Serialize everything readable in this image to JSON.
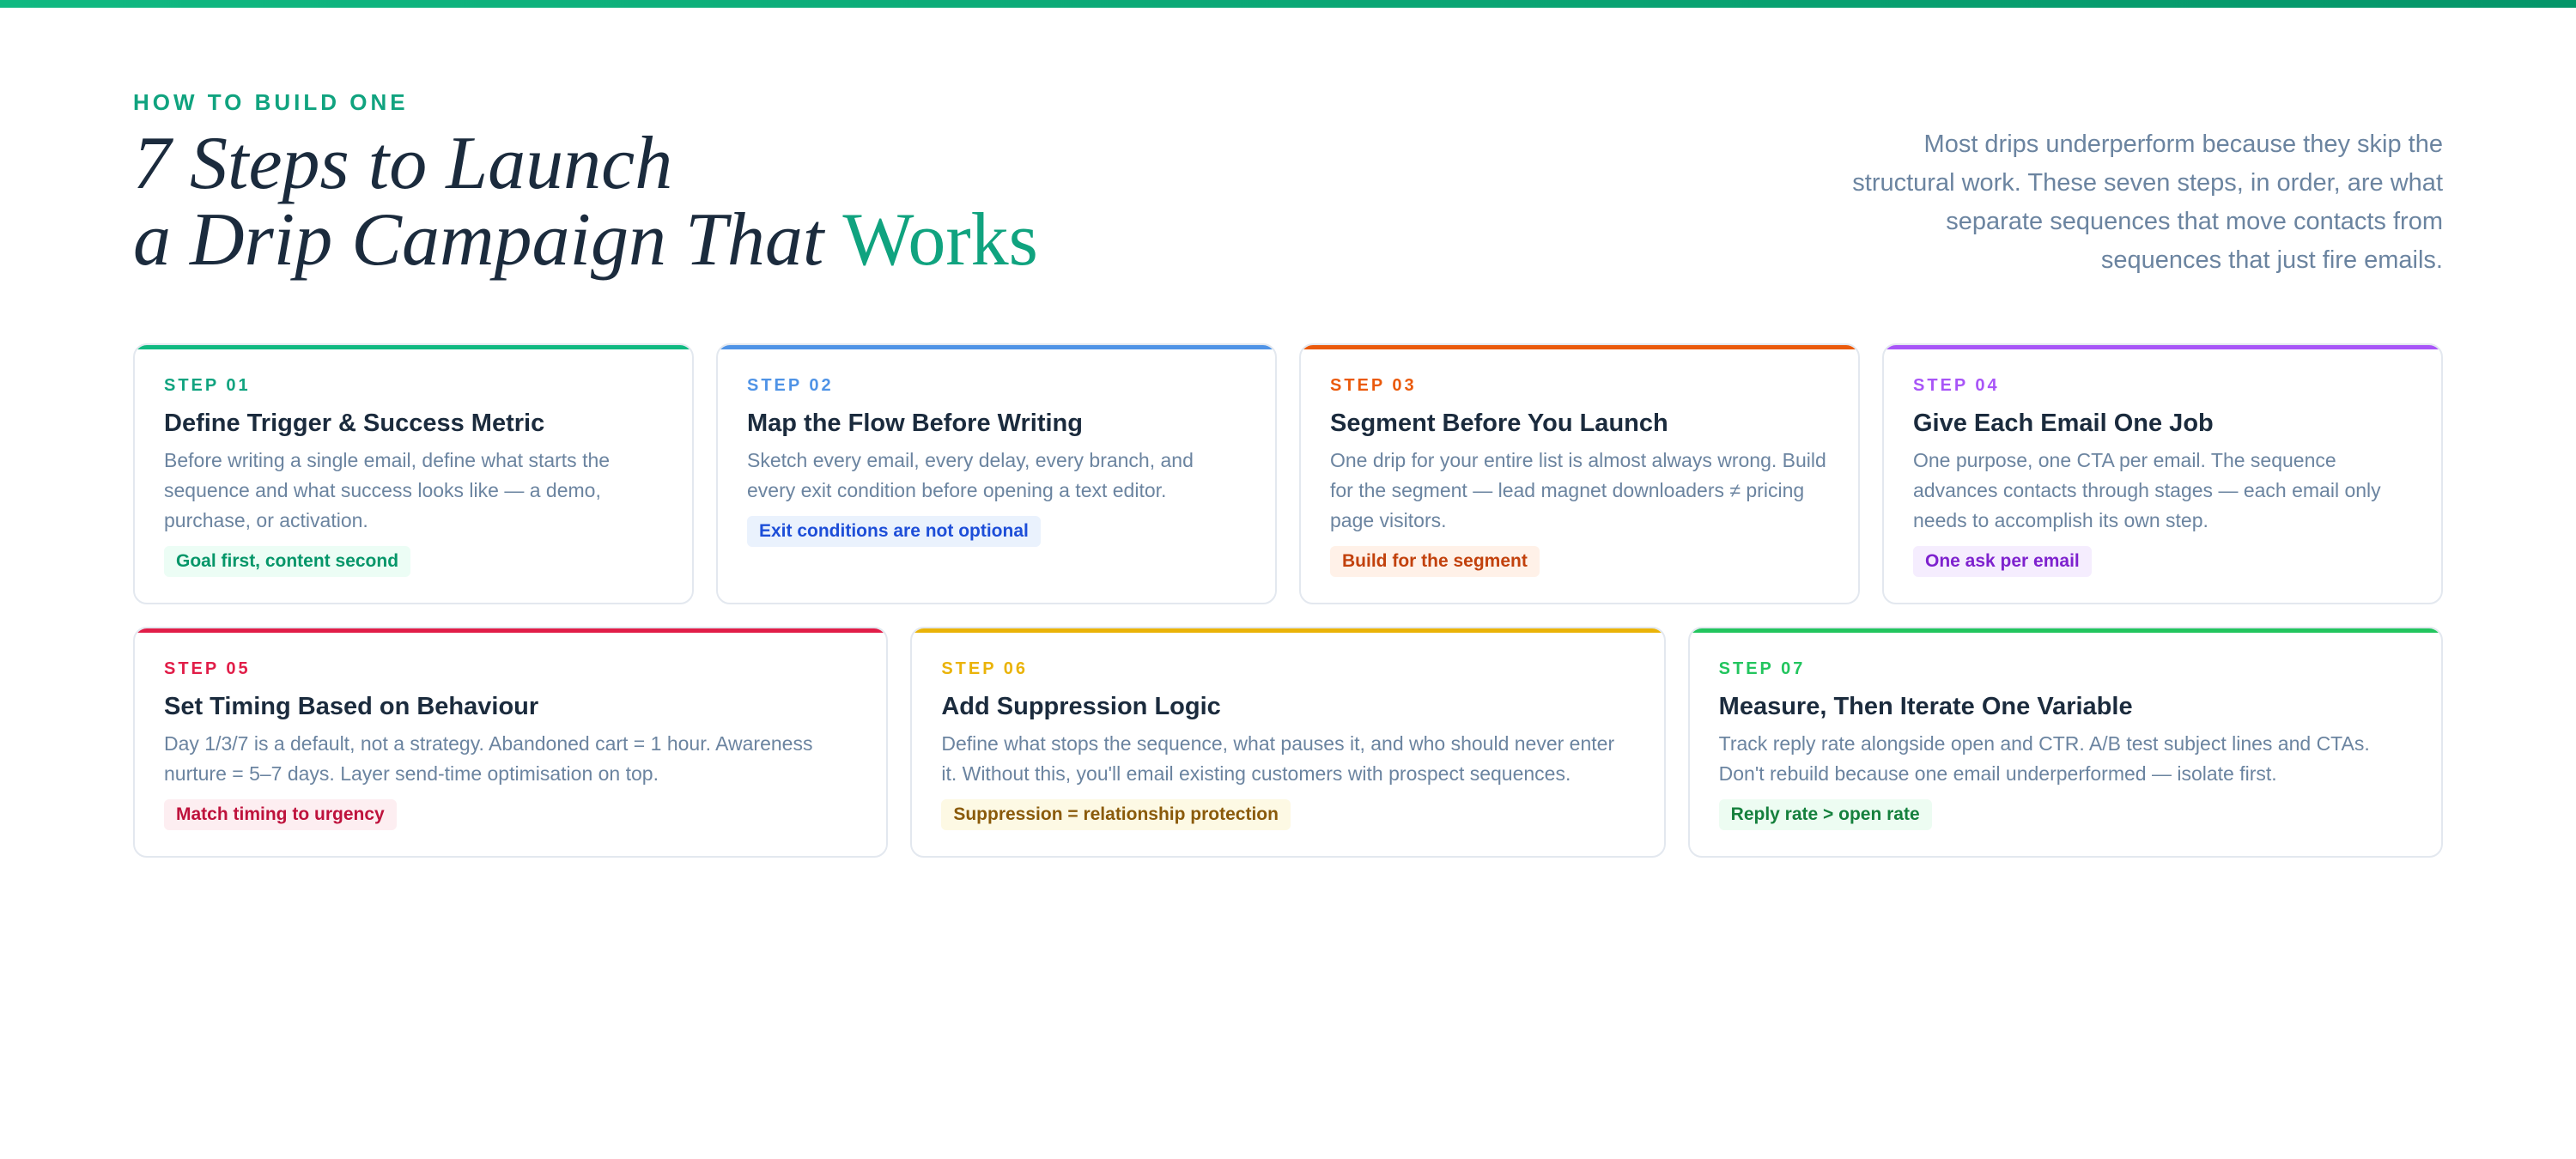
{
  "header": {
    "eyebrow": "HOW TO BUILD ONE",
    "title_line1": "7 Steps to Launch",
    "title_line2_prefix": "a Drip Campaign That ",
    "title_line2_accent": "Works",
    "intro": "Most drips underperform because they skip the structural work. These seven steps, in order, are what separate sequences that move contacts from sequences that just fire emails."
  },
  "steps": [
    {
      "label": "STEP 01",
      "title": "Define Trigger & Success Metric",
      "description": "Before writing a single email, define what starts the sequence and what success looks like — a demo, purchase, or activation.",
      "tag": "Goal first, content second",
      "accent_color": "#10b981"
    },
    {
      "label": "STEP 02",
      "title": "Map the Flow Before Writing",
      "description": "Sketch every email, every delay, every branch, and every exit condition before opening a text editor.",
      "tag": "Exit conditions are not optional",
      "accent_color": "#4f93e6"
    },
    {
      "label": "STEP 03",
      "title": "Segment Before You Launch",
      "description": "One drip for your entire list is almost always wrong. Build for the segment — lead magnet downloaders ≠ pricing page visitors.",
      "tag": "Build for the segment",
      "accent_color": "#ea5a0c"
    },
    {
      "label": "STEP 04",
      "title": "Give Each Email One Job",
      "description": "One purpose, one CTA per email. The sequence advances contacts through stages — each email only needs to accomplish its own step.",
      "tag": "One ask per email",
      "accent_color": "#a855f7"
    },
    {
      "label": "STEP 05",
      "title": "Set Timing Based on Behaviour",
      "description": "Day 1/3/7 is a default, not a strategy. Abandoned cart = 1 hour. Awareness nurture = 5–7 days. Layer send-time optimisation on top.",
      "tag": "Match timing to urgency",
      "accent_color": "#e11d48"
    },
    {
      "label": "STEP 06",
      "title": "Add Suppression Logic",
      "description": "Define what stops the sequence, what pauses it, and who should never enter it. Without this, you'll email existing customers with prospect sequences.",
      "tag": "Suppression = relationship protection",
      "accent_color": "#eab308"
    },
    {
      "label": "STEP 07",
      "title": "Measure, Then Iterate One Variable",
      "description": "Track reply rate alongside open and CTR. A/B test subject lines and CTAs. Don't rebuild because one email underperformed — isolate first.",
      "tag": "Reply rate > open rate",
      "accent_color": "#22c55e"
    }
  ]
}
